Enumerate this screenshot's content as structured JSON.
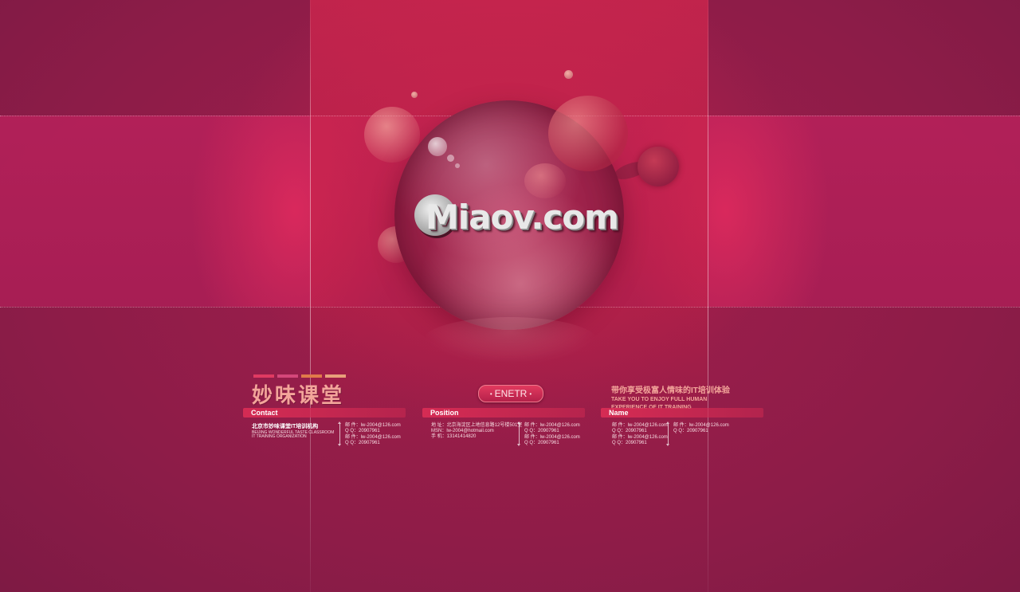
{
  "colors": {
    "background": "#8e1d4a",
    "accent": "#e23a5f",
    "brand_text": "#f3a59a",
    "brand_bars": [
      "#e03a62",
      "#d4477a",
      "#e07a4a",
      "#e8a07a"
    ]
  },
  "logo": {
    "text": "Miaov.com",
    "icon": "miaov-c-logo-icon"
  },
  "brand": {
    "title": "妙味课堂"
  },
  "enter_button": {
    "label": "ENETR"
  },
  "slogan": {
    "cn": "带你享受极富人情味的IT培训体验",
    "en_line1": "TAKE YOU TO ENJOY FULL HUMAN",
    "en_line2": "EXPERIENCE OF IT TRAINING"
  },
  "columns": {
    "contact": {
      "header": "Contact",
      "org_cn": "北京市妙味课堂IT培训机构",
      "org_en1": "BEIJING WONDERFUL TASTE CLASSROOM",
      "org_en2": "IT TRAINING ORGANIZATION",
      "entries": [
        {
          "email": "邮 件：lw-2004@126.com",
          "qq": "Q  Q：20907961"
        },
        {
          "email": "邮 件：lw-2004@126.com",
          "qq": "Q  Q：20907961"
        }
      ]
    },
    "position": {
      "header": "Position",
      "address": "地 址：北京海淀区上地信息路12号楼501室",
      "msn": "MSN：lw-2004@hotmail.com",
      "phone": "手 机：13141414820",
      "entries": [
        {
          "email": "邮 件：lw-2004@126.com",
          "qq": "Q  Q：20907961"
        },
        {
          "email": "邮 件：lw-2004@126.com",
          "qq": "Q  Q：20907961"
        }
      ]
    },
    "name": {
      "header": "Name",
      "entries_left": [
        {
          "email": "邮 件：lw-2004@126.com",
          "qq": "Q  Q：20907961"
        },
        {
          "email": "邮 件：lw-2004@126.com",
          "qq": "Q  Q：20907961"
        }
      ],
      "entries_right": [
        {
          "email": "邮 件：lw-2004@126.com",
          "qq": "Q  Q：20907961"
        }
      ]
    }
  }
}
